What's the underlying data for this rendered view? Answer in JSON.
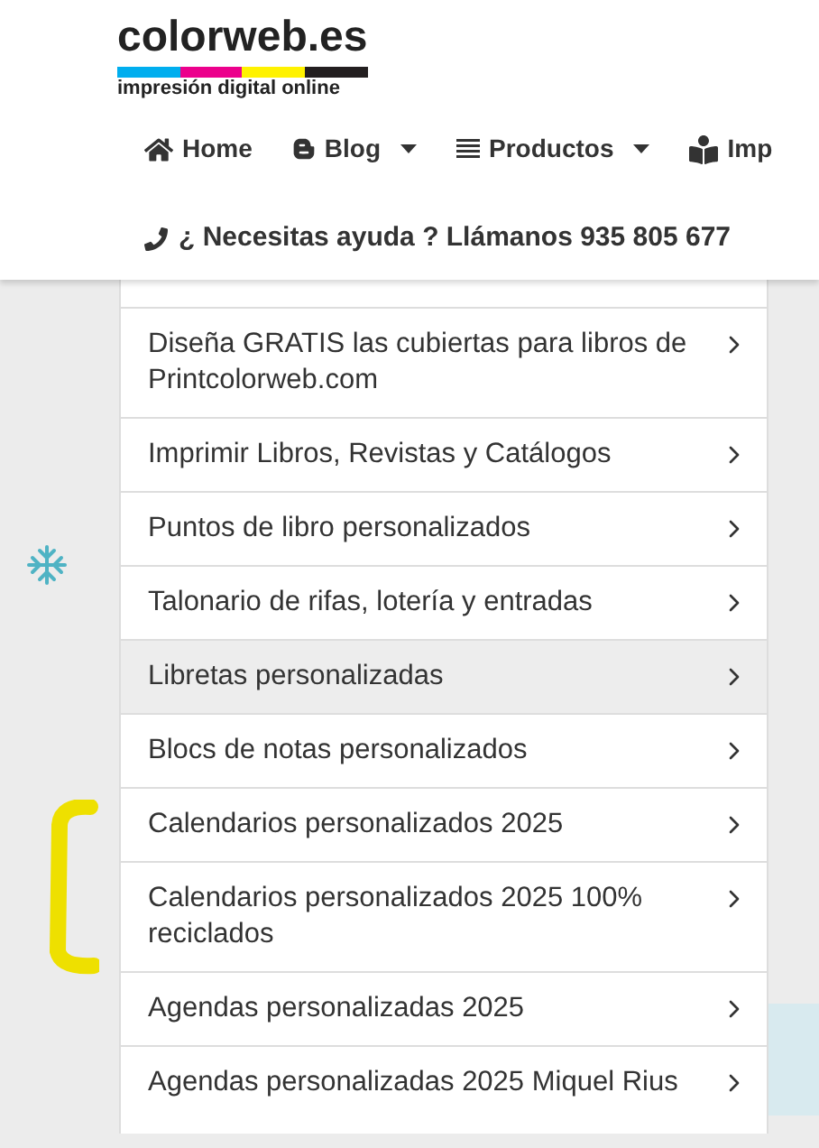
{
  "logo": {
    "name": "colorweb.es",
    "tagline": "impresión digital online"
  },
  "nav": [
    {
      "label": "Home",
      "kind": "home",
      "dropdown": false
    },
    {
      "label": "Blog",
      "kind": "blog",
      "dropdown": true
    },
    {
      "label": "Productos",
      "kind": "list",
      "dropdown": true
    },
    {
      "label": "Imp",
      "kind": "book",
      "dropdown": false
    }
  ],
  "help": {
    "text": "¿ Necesitas ayuda ? Llámanos 935 805 677"
  },
  "menu": [
    {
      "label": "Diseña GRATIS las cubiertas para libros de Printcolorweb.com",
      "selected": false
    },
    {
      "label": "Imprimir Libros, Revistas y Catálogos",
      "selected": false
    },
    {
      "label": "Puntos de libro personalizados",
      "selected": false
    },
    {
      "label": "Talonario de rifas, lotería y entradas",
      "selected": false
    },
    {
      "label": "Libretas personalizadas",
      "selected": true
    },
    {
      "label": "Blocs de notas personalizados",
      "selected": false
    },
    {
      "label": "Calendarios personalizados 2025",
      "selected": false
    },
    {
      "label": "Calendarios personalizados 2025 100% reciclados",
      "selected": false
    },
    {
      "label": "Agendas personalizadas 2025",
      "selected": false
    },
    {
      "label": "Agendas personalizadas 2025 Miquel Rius",
      "selected": false
    }
  ]
}
